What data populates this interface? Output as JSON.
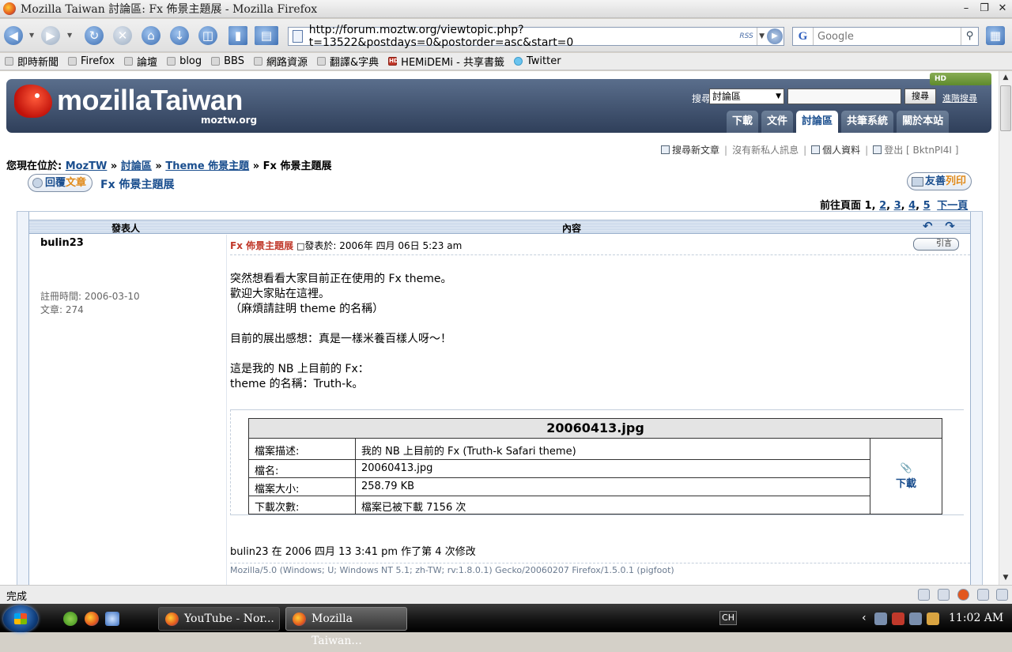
{
  "window": {
    "title": "Mozilla Taiwan 討論區: Fx 佈景主題展 - Mozilla Firefox"
  },
  "toolbar": {
    "url": "http://forum.moztw.org/viewtopic.php?t=13522&postdays=0&postorder=asc&start=0",
    "rss": "RSS",
    "search_placeholder": "Google",
    "search_engine_icon": "G"
  },
  "bookmarks": [
    {
      "label": "即時新聞",
      "icon": "rss-folder-icon"
    },
    {
      "label": "Firefox",
      "icon": "rss-folder-icon"
    },
    {
      "label": "論壇",
      "icon": "rss-folder-icon"
    },
    {
      "label": "blog",
      "icon": "rss-folder-icon"
    },
    {
      "label": "BBS",
      "icon": "rss-folder-icon"
    },
    {
      "label": "網路資源",
      "icon": "rss-folder-icon"
    },
    {
      "label": "翻譯&字典",
      "icon": "rss-folder-icon"
    },
    {
      "label": "HEMiDEMi - 共享書籤",
      "icon": "hd-icon"
    },
    {
      "label": "Twitter",
      "icon": "twitter-icon"
    }
  ],
  "site": {
    "logo_text": "mozillaTaiwan",
    "logo_sub": "moztw.org",
    "search_label": "搜尋",
    "search_scope": "討論區",
    "search_button": "搜尋",
    "advanced_search": "進階搜尋",
    "hd_badge": "HD",
    "tabs": [
      "下載",
      "文件",
      "討論區",
      "共筆系統",
      "關於本站"
    ],
    "active_tab": "討論區"
  },
  "userlinks": {
    "search_new": "搜尋新文章",
    "no_pm": "沒有新私人訊息",
    "profile": "個人資料",
    "logout": "登出 [ BktnPI4I ]"
  },
  "breadcrumb": {
    "prefix": "您現在位於:",
    "items": [
      "MozTW",
      "討論區",
      "Theme 佈景主題"
    ],
    "current": "Fx 佈景主題展",
    "sep": "»"
  },
  "topic": {
    "reply_a": "回覆",
    "reply_b": "文章",
    "title": "Fx 佈景主題展",
    "print_a": "友善",
    "print_b": "列印",
    "pager_prefix": "前往頁面",
    "pager_current": "1",
    "pages": [
      "2",
      "3",
      "4",
      "5"
    ],
    "next": "下一頁"
  },
  "table_header": {
    "author": "發表人",
    "content": "內容"
  },
  "post": {
    "author": "bulin23",
    "joined": "註冊時間: 2006-03-10",
    "posts": "文章: 274",
    "subject": "Fx 佈景主題展",
    "posted": "發表於: 2006年 四月 06日 5:23 am",
    "quote": "引言",
    "body": "突然想看看大家目前正在使用的 Fx theme。\n歡迎大家貼在這裡。\n（麻煩請註明 theme 的名稱）\n\n目前的展出感想：真是一樣米養百樣人呀～！\n\n這是我的 NB 上目前的 Fx：\ntheme 的名稱：Truth-k。",
    "edit_note": "bulin23 在 2006 四月 13 3:41 pm 作了第 4 次修改",
    "signature": "Mozilla/5.0 (Windows; U; Windows NT 5.1; zh-TW; rv:1.8.0.1) Gecko/20060207 Firefox/1.5.0.1 (pigfoot)"
  },
  "attachment": {
    "filename_title": "20060413.jpg",
    "rows": [
      {
        "key": "檔案描述:",
        "value": "我的 NB 上目前的 Fx (Truth-k Safari theme)"
      },
      {
        "key": "檔名:",
        "value": "20060413.jpg"
      },
      {
        "key": "檔案大小:",
        "value": "258.79 KB"
      },
      {
        "key": "下載次數:",
        "value": "檔案已被下載 7156 次"
      }
    ],
    "download": "下載"
  },
  "status": {
    "text": "完成"
  },
  "taskbar": {
    "buttons": [
      {
        "label": "YouTube - Nor...",
        "active": false
      },
      {
        "label": "Mozilla Taiwan...",
        "active": true
      }
    ],
    "lang": "CH",
    "clock": "11:02 AM"
  }
}
